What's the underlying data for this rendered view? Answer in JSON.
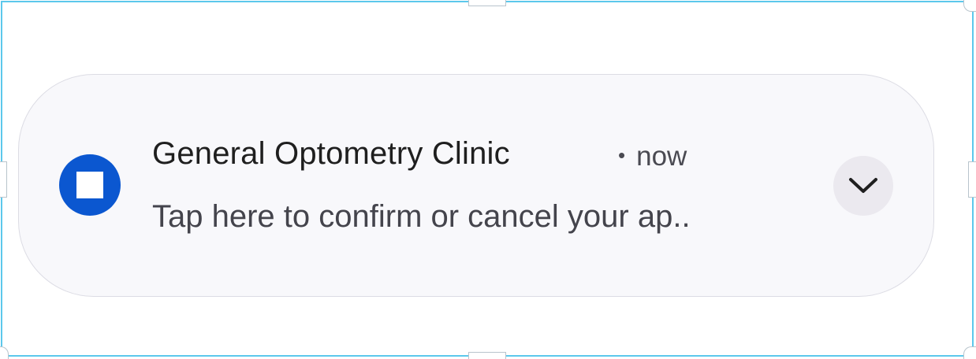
{
  "notification": {
    "app_name": "General Optometry Clinic",
    "separator": "•",
    "time": "now",
    "message": "Tap here to confirm or cancel your ap..",
    "icon": "app-square-icon",
    "expand_icon": "chevron-down-icon"
  },
  "colors": {
    "icon_bg": "#0b57d0",
    "card_bg": "#f8f8fb",
    "frame_border": "#5cc8ec",
    "expand_bg": "#ebe9ef"
  }
}
